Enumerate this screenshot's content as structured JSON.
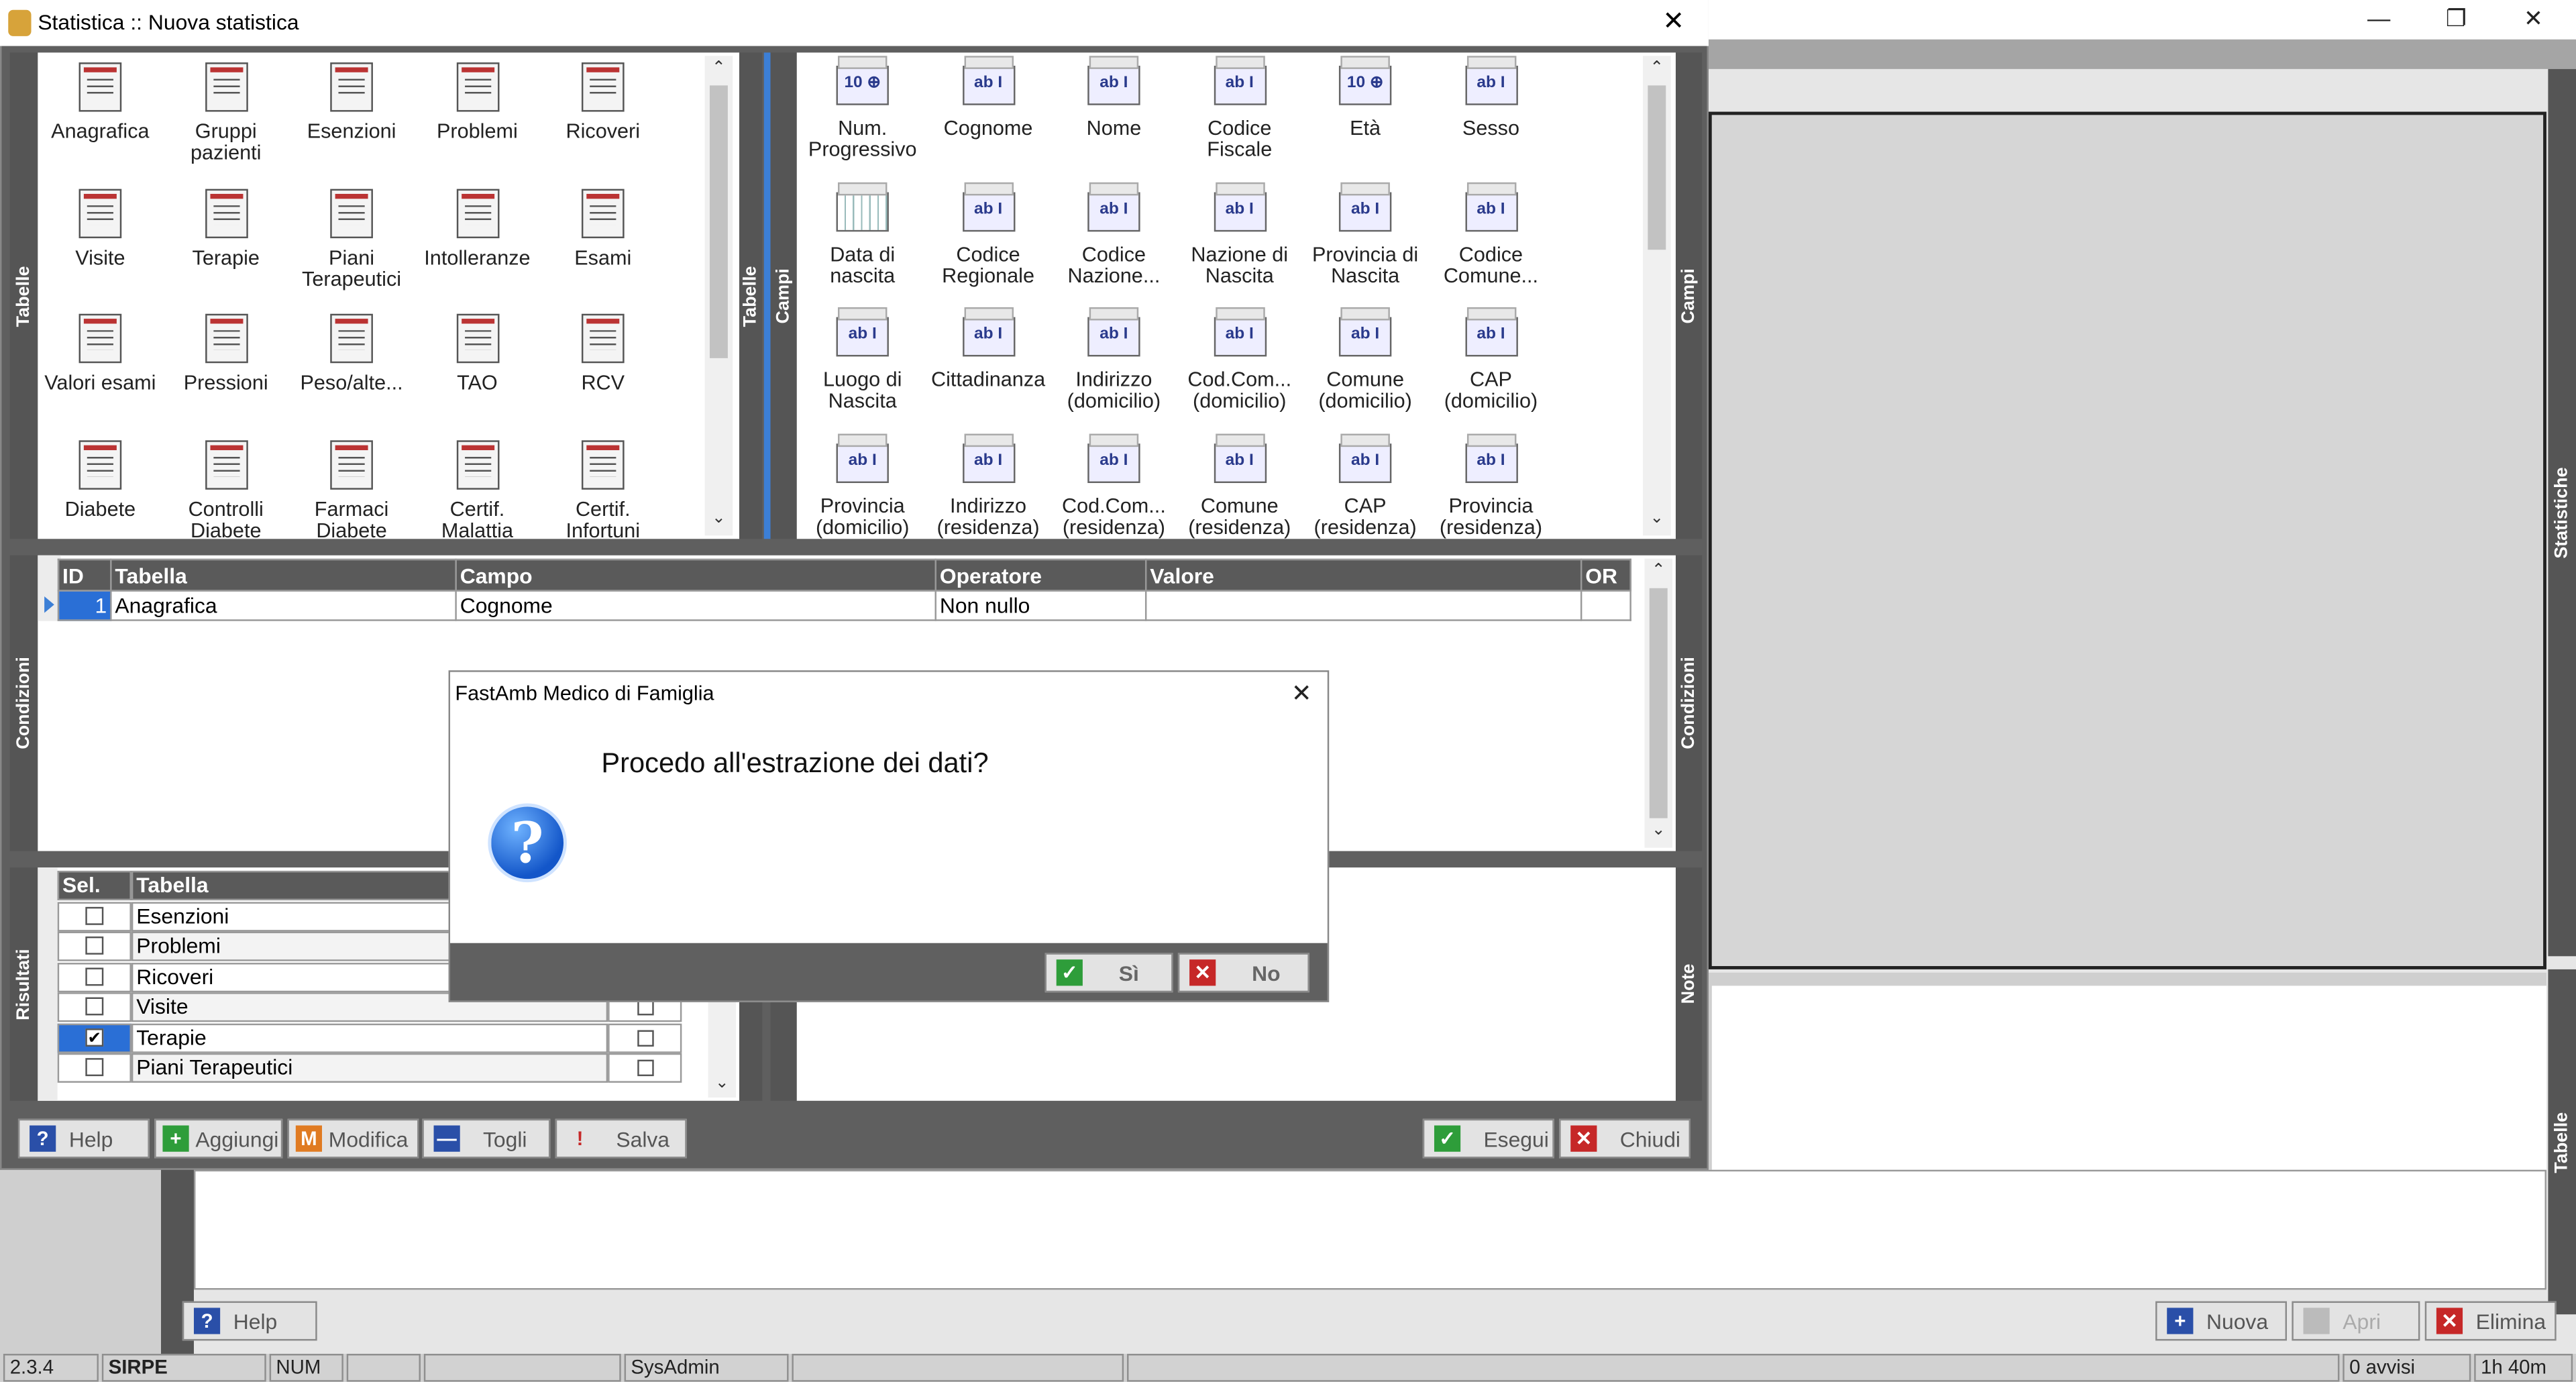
{
  "main_window": {
    "side_tabs": {
      "statistiche": "Statistiche",
      "tabelle": "Tabelle"
    },
    "buttons": {
      "help": "Help",
      "nuova": "Nuova",
      "apri": "Apri",
      "elimina": "Elimina"
    },
    "status_bar": [
      "2.3.4",
      "SIRPE",
      "NUM",
      "",
      "",
      "SysAdmin",
      "",
      "",
      "0 avvisi",
      "1h 40m"
    ]
  },
  "dialog": {
    "title": "Statistica :: Nuova statistica",
    "labels": {
      "tabelle": "Tabelle",
      "campi": "Campi",
      "condizioni": "Condizioni",
      "risultati": "Risultati",
      "note": "Note",
      "ri": "Ri"
    },
    "tables": [
      "Anagrafica",
      "Gruppi\npazienti",
      "Esenzioni",
      "Problemi",
      "Ricoveri",
      "Visite",
      "Terapie",
      "Piani\nTerapeutici",
      "Intolleranze",
      "Esami",
      "Valori esami",
      "Pressioni",
      "Peso/alte...",
      "TAO",
      "RCV",
      "Diabete",
      "Controlli\nDiabete",
      "Farmaci\nDiabete",
      "Certif.\nMalattia",
      "Certif.\nInfortuni"
    ],
    "fields": [
      {
        "label": "Num.\nProgressivo",
        "icon": "10"
      },
      {
        "label": "Cognome",
        "icon": "abI"
      },
      {
        "label": "Nome",
        "icon": "abI"
      },
      {
        "label": "Codice\nFiscale",
        "icon": "abI"
      },
      {
        "label": "Età",
        "icon": "10"
      },
      {
        "label": "Sesso",
        "icon": "abI"
      },
      {
        "label": "Data di\nnascita",
        "icon": "cal"
      },
      {
        "label": "Codice\nRegionale",
        "icon": "abI"
      },
      {
        "label": "Codice\nNazione...",
        "icon": "abI"
      },
      {
        "label": "Nazione di\nNascita",
        "icon": "abI"
      },
      {
        "label": "Provincia di\nNascita",
        "icon": "abI"
      },
      {
        "label": "Codice\nComune...",
        "icon": "abI"
      },
      {
        "label": "Luogo di\nNascita",
        "icon": "abI"
      },
      {
        "label": "Cittadinanza",
        "icon": "abI"
      },
      {
        "label": "Indirizzo\n(domicilio)",
        "icon": "abI"
      },
      {
        "label": "Cod.Com...\n(domicilio)",
        "icon": "abI"
      },
      {
        "label": "Comune\n(domicilio)",
        "icon": "abI"
      },
      {
        "label": "CAP\n(domicilio)",
        "icon": "abI"
      },
      {
        "label": "Provincia\n(domicilio)",
        "icon": "abI"
      },
      {
        "label": "Indirizzo\n(residenza)",
        "icon": "abI"
      },
      {
        "label": "Cod.Com...\n(residenza)",
        "icon": "abI"
      },
      {
        "label": "Comune\n(residenza)",
        "icon": "abI"
      },
      {
        "label": "CAP\n(residenza)",
        "icon": "abI"
      },
      {
        "label": "Provincia\n(residenza)",
        "icon": "abI"
      }
    ],
    "conditions": {
      "headers": [
        "ID",
        "Tabella",
        "Campo",
        "Operatore",
        "Valore",
        "OR"
      ],
      "rows": [
        {
          "id": "1",
          "tabella": "Anagrafica",
          "campo": "Cognome",
          "operatore": "Non nullo",
          "valore": "",
          "or": ""
        }
      ]
    },
    "results": {
      "headers": [
        "Sel.",
        "Tabella"
      ],
      "rows": [
        {
          "name": "Esenzioni",
          "checked": false
        },
        {
          "name": "Problemi",
          "checked": false
        },
        {
          "name": "Ricoveri",
          "checked": false
        },
        {
          "name": "Visite",
          "checked": false
        },
        {
          "name": "Terapie",
          "checked": true
        },
        {
          "name": "Piani Terapeutici",
          "checked": false
        }
      ]
    },
    "buttons": {
      "help": "Help",
      "aggiungi": "Aggiungi",
      "modifica": "Modifica",
      "togli": "Togli",
      "salva": "Salva",
      "esegui": "Esegui",
      "chiudi": "Chiudi"
    }
  },
  "modal": {
    "title": "FastAmb Medico di Famiglia",
    "message": "Procedo all'estrazione dei dati?",
    "yes": "Sì",
    "no": "No"
  }
}
